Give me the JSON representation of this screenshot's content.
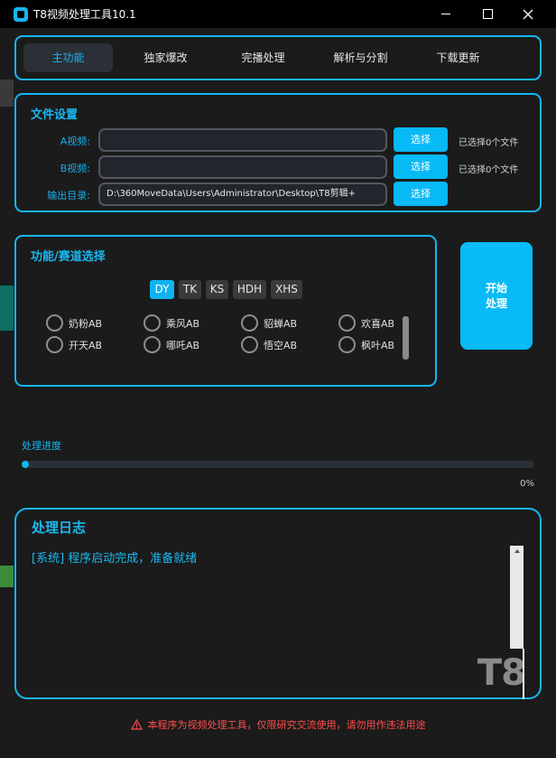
{
  "window": {
    "title": "T8视频处理工具10.1"
  },
  "nav": {
    "tabs": [
      {
        "label": "主功能",
        "active": true
      },
      {
        "label": "独家爆改",
        "active": false
      },
      {
        "label": "完播处理",
        "active": false
      },
      {
        "label": "解析与分割",
        "active": false
      },
      {
        "label": "下载更新",
        "active": false
      }
    ]
  },
  "file_settings": {
    "title": "文件设置",
    "rows": [
      {
        "label": "A视频:",
        "value": "",
        "button": "选择",
        "status": "已选择0个文件"
      },
      {
        "label": "B视频:",
        "value": "",
        "button": "选择",
        "status": "已选择0个文件"
      },
      {
        "label": "输出目录:",
        "value": "D:\\360MoveData\\Users\\Administrator\\Desktop\\T8剪辑+",
        "button": "选择",
        "status": ""
      }
    ]
  },
  "function_select": {
    "title": "功能/赛道选择",
    "platforms": [
      {
        "label": "DY",
        "active": true
      },
      {
        "label": "TK",
        "active": false
      },
      {
        "label": "KS",
        "active": false
      },
      {
        "label": "HDH",
        "active": false
      },
      {
        "label": "XHS",
        "active": false
      }
    ],
    "options": [
      "奶粉AB",
      "乘风AB",
      "貂蝉AB",
      "欢喜AB",
      "开天AB",
      "哪吒AB",
      "悟空AB",
      "枫叶AB"
    ]
  },
  "start_button": {
    "line1": "开始",
    "line2": "处理"
  },
  "progress": {
    "title": "处理进度",
    "percent_label": "0%",
    "value": 0
  },
  "log": {
    "title": "处理日志",
    "lines": [
      "[系统] 程序启动完成，准备就绪"
    ],
    "watermark": "T8"
  },
  "footer": {
    "note": "本程序为视频处理工具，仅限研究交流使用，请勿用作违法用途"
  },
  "colors": {
    "accent": "#16b7f2",
    "background": "#1b1b1b",
    "warning": "#ff4c4c"
  }
}
